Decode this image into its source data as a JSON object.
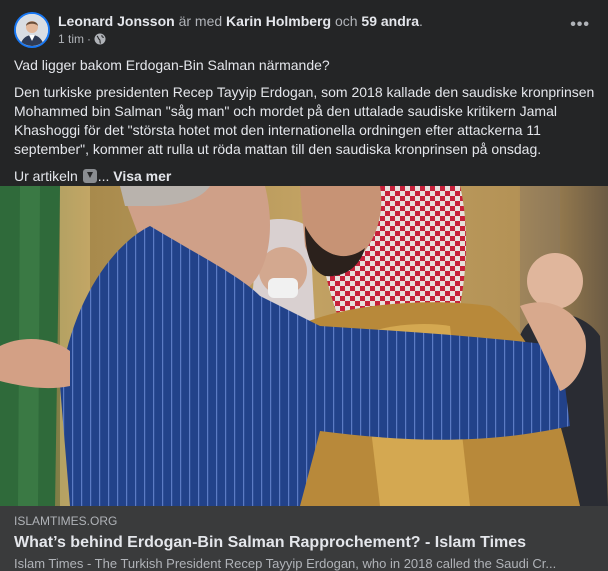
{
  "post": {
    "author": "Leonard Jonsson",
    "with_text": " är med ",
    "tagged_person": "Karin Holmberg",
    "and_text": " och ",
    "others": "59 andra",
    "period": ".",
    "time": "1 tim",
    "dot": "·",
    "privacy_icon": "globe-icon",
    "more_icon": "•••"
  },
  "body": {
    "question": "Vad ligger bakom Erdogan-Bin Salman närmande?",
    "paragraph": "Den turkiske presidenten Recep Tayyip Erdogan, som 2018 kallade den saudiske kronprinsen Mohammed bin Salman \"såg man\" och mordet på den uttalade saudiske kritikern Jamal Khashoggi för det \"största hotet mot den internationella ordningen efter attackerna 11 september\", kommer att rulla ut röda mattan till den saudiska kronprinsen på onsdag.",
    "source_prefix": "Ur artikeln",
    "ellipsis": "...",
    "see_more": "Visa mer"
  },
  "link": {
    "domain": "ISLAMTIMES.ORG",
    "title": "What’s behind Erdogan-Bin Salman Rapprochement? - Islam Times",
    "description": "Islam Times - The Turkish President Recep Tayyip Erdogan, who in 2018 called the Saudi Cr..."
  },
  "colors": {
    "background": "#242526",
    "link_box": "#3a3b3c",
    "accent": "#1877f2"
  }
}
